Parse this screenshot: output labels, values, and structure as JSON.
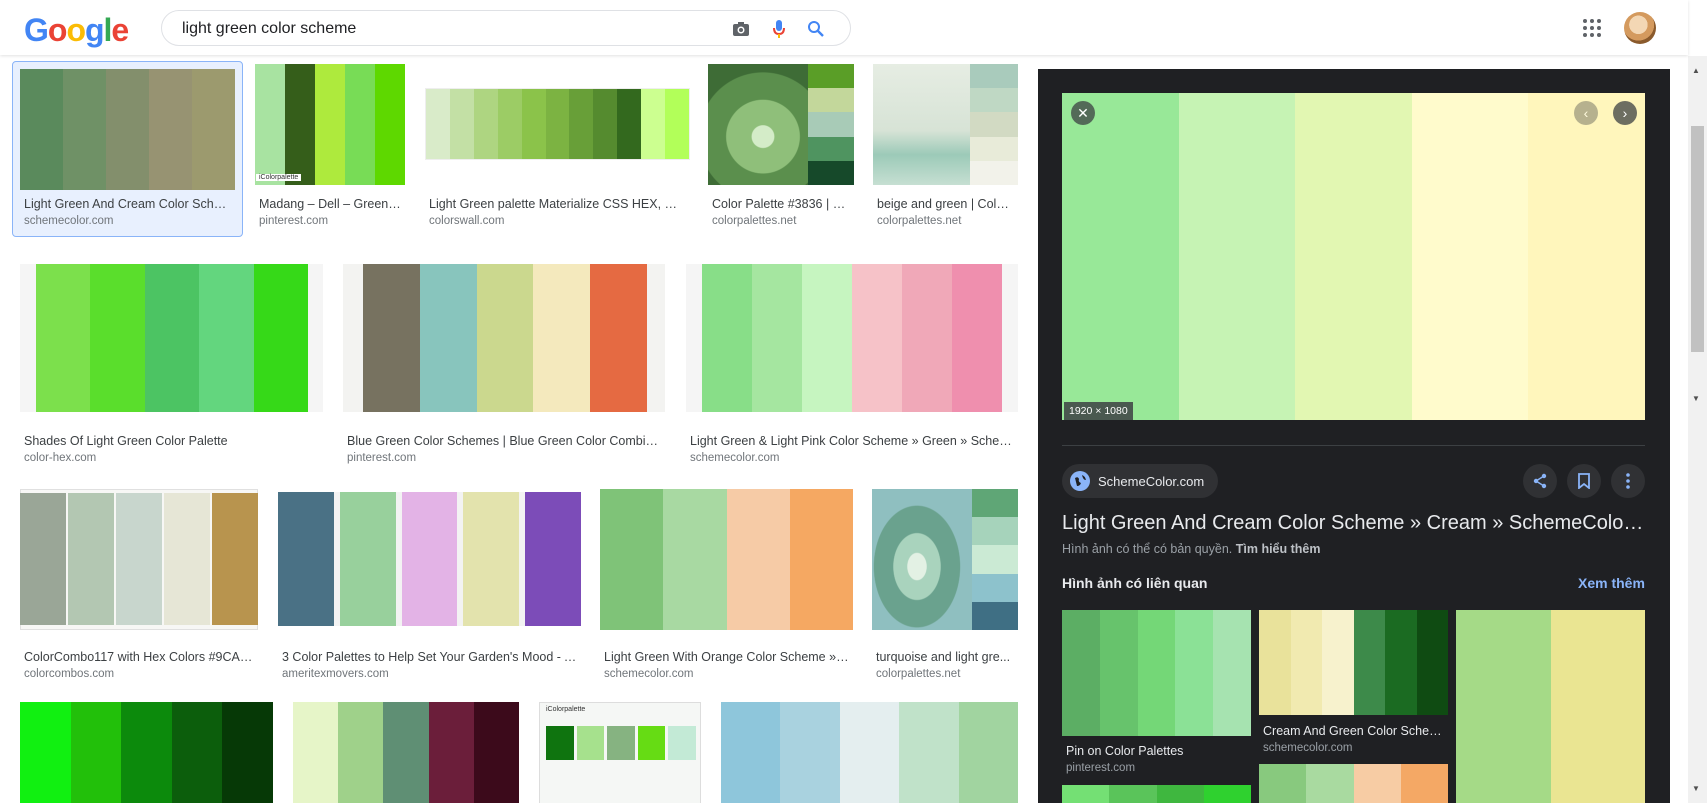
{
  "header": {
    "logo": [
      "G",
      "o",
      "o",
      "g",
      "l",
      "e"
    ],
    "logo_colors": [
      "#4285F4",
      "#EA4335",
      "#FBBC05",
      "#4285F4",
      "#34A853",
      "#EA4335"
    ],
    "search_value": "light green color scheme",
    "icons": [
      "camera-icon",
      "mic-icon",
      "search-icon",
      "apps-icon"
    ]
  },
  "results": [
    {
      "title": "Light Green And Cream Color Sche...",
      "source": "schemecolor.com",
      "colors": [
        "#5a8a5c",
        "#6f9166",
        "#838f6c",
        "#979372",
        "#9c9a6e"
      ]
    },
    {
      "title": "Madang – Dell – Green ...",
      "source": "pinterest.com",
      "colors": [
        "#a8e3a1",
        "#355e1a",
        "#aeea3d",
        "#78dc56",
        "#5ed800"
      ],
      "caption": "iColorpalette"
    },
    {
      "title": "Light Green palette Materialize CSS HEX, RG...",
      "source": "colorswall.com",
      "colors": [
        "#d9ebc9",
        "#c3e0a5",
        "#aed581",
        "#9ccc65",
        "#8bc34a",
        "#7cb342",
        "#689f38",
        "#558b2f",
        "#33691e",
        "#ccff90",
        "#b2ff59"
      ]
    },
    {
      "title": "Color Palette #3836 | C...",
      "source": "colorpalettes.net",
      "colors": [
        "#5a9e27",
        "#c3d79b",
        "#a8cbb7",
        "#4f9460",
        "#16492a"
      ]
    },
    {
      "title": "beige and green | Color...",
      "source": "colorpalettes.net",
      "colors": [
        "#a9cbbc",
        "#bfd8c4",
        "#d2dac3",
        "#e8ebd9",
        "#f2f2ea"
      ]
    },
    {
      "title": "Shades Of Light Green Color Palette",
      "source": "color-hex.com",
      "colors": [
        "#7ce04c",
        "#5ade2c",
        "#4cc463",
        "#63d67e",
        "#36d918"
      ]
    },
    {
      "title": "Blue Green Color Schemes | Blue Green Color Combinat...",
      "source": "pinterest.com",
      "colors": [
        "#777260",
        "#88c5bd",
        "#cbd88e",
        "#f4e9bd",
        "#e56a42"
      ]
    },
    {
      "title": "Light Green & Light Pink Color Scheme » Green » Scheme...",
      "source": "schemecolor.com",
      "colors": [
        "#88de88",
        "#a5e6a0",
        "#c6f5c0",
        "#f6c2c8",
        "#f0a8b8",
        "#ef8fae"
      ]
    },
    {
      "title": "ColorCombo117 with Hex Colors #9CAA...",
      "source": "colorcombos.com",
      "colors": [
        "#9aa697",
        "#b3c7b2",
        "#c8d6cd",
        "#e6e6d6",
        "#b8944e"
      ]
    },
    {
      "title": "3 Color Palettes to Help Set Your Garden's Mood - A...",
      "source": "ameritexmovers.com",
      "colors": [
        "#4a7185",
        "#98d09c",
        "#e3b3e6",
        "#e3e3ad",
        "#7c4cb8"
      ]
    },
    {
      "title": "Light Green With Orange Color Scheme » G...",
      "source": "schemecolor.com",
      "colors": [
        "#7fc378",
        "#a8d9a2",
        "#f6cba6",
        "#f5a862"
      ]
    },
    {
      "title": "turquoise and light gre...",
      "source": "colorpalettes.net",
      "colors": [
        "#5fa676",
        "#a6d3bb",
        "#cbead4",
        "#8dc2cc",
        "#3f6f84"
      ]
    },
    {
      "title": "",
      "source": "",
      "colors": [
        "#11f011",
        "#22c00a",
        "#0c8a0c",
        "#0c5e0c",
        "#063906"
      ]
    },
    {
      "title": "",
      "source": "",
      "colors": [
        "#e6f5c8",
        "#9fd18a",
        "#5f8f74",
        "#6b1e3a",
        "#3c0a1b"
      ]
    },
    {
      "title": "",
      "source": "",
      "colors": [
        "#0f740f",
        "#a6e18d",
        "#86b381",
        "#66dc14",
        "#c3ead6"
      ],
      "caption": "iColorpalette"
    },
    {
      "title": "",
      "source": "",
      "colors": [
        "#8ec6db",
        "#a9d2df",
        "#e4eeef",
        "#c0e2c9",
        "#a1d4a0"
      ]
    }
  ],
  "panel": {
    "preview_colors": [
      "#98e898",
      "#c6f3b4",
      "#e2f7b2",
      "#fffbcc",
      "#fff6bc"
    ],
    "dimensions": "1920 × 1080",
    "site_name": "SchemeColor.com",
    "title": "Light Green And Cream Color Scheme » Cream » SchemeColor.com",
    "copyright_note": "Hình ảnh có thể có bản quyền.",
    "learn_more": "Tìm hiểu thêm",
    "related_heading": "Hình ảnh có liên quan",
    "see_more": "Xem thêm",
    "related": [
      {
        "title": "Pin on Color Palettes",
        "source": "pinterest.com",
        "colors": [
          "#5cae64",
          "#67c36c",
          "#74d777",
          "#8be196",
          "#a6e3b0"
        ]
      },
      {
        "title": "Cream And Green Color Schem...",
        "source": "schemecolor.com",
        "colors": [
          "#e9e29b",
          "#f1eab0",
          "#f7f2cd",
          "#3d8a4a",
          "#1b6b22",
          "#0f4b12"
        ]
      },
      {
        "title": "",
        "source": "",
        "colors": [
          "#a5da87",
          "#eae592"
        ]
      },
      {
        "title": "",
        "source": "",
        "colors": [
          "#74e074",
          "#5ac45a",
          "#3fb73f",
          "#2fd12f"
        ]
      },
      {
        "title": "",
        "source": "",
        "colors": [
          "#88c97e",
          "#a9daa0",
          "#f7cca4",
          "#f4a865"
        ]
      }
    ]
  }
}
